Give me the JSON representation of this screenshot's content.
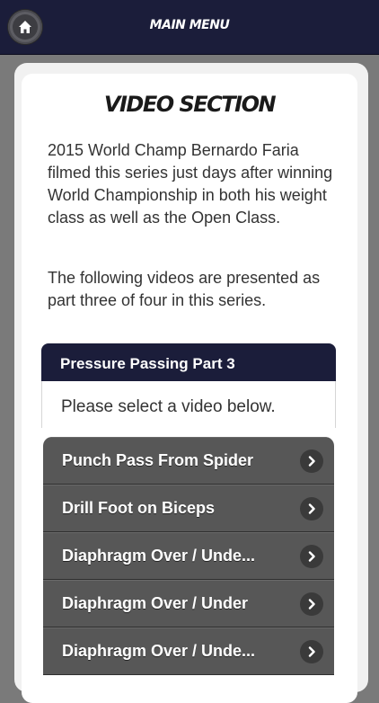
{
  "header": {
    "title": "MAIN MENU",
    "home_icon": "home-icon"
  },
  "section": {
    "title": "VIDEO SECTION",
    "paragraphs": [
      "2015 World Champ Bernardo Faria filmed this series just days after winning World Championship in both his weight class as well as the Open Class.",
      "The following videos are presented as part three of four in this series."
    ]
  },
  "panel": {
    "title": "Pressure Passing Part 3",
    "instruction": "Please select a video below."
  },
  "videos": [
    {
      "label": "Punch Pass From Spider"
    },
    {
      "label": "Drill Foot on Biceps"
    },
    {
      "label": "Diaphragm Over / Unde..."
    },
    {
      "label": "Diaphragm Over / Under"
    },
    {
      "label": "Diaphragm Over / Unde..."
    }
  ],
  "colors": {
    "header_bg": "#1b1d3a",
    "list_item_bg": "#575757",
    "page_bg": "#7a7a7a"
  }
}
